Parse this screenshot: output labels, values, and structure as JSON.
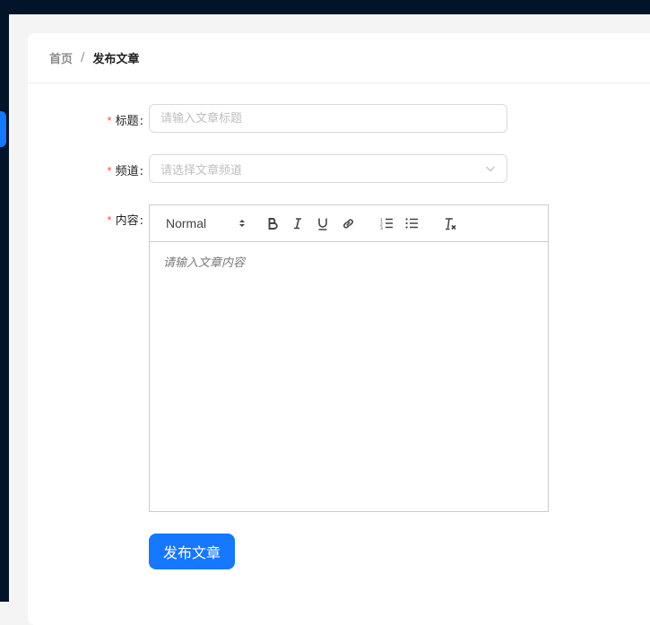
{
  "breadcrumb": {
    "home": "首页",
    "separator": "/",
    "current": "发布文章"
  },
  "form": {
    "title": {
      "label": "标题",
      "placeholder": "请输入文章标题",
      "value": ""
    },
    "channel": {
      "label": "频道",
      "placeholder": "请选择文章频道"
    },
    "content": {
      "label": "内容",
      "placeholder": "请输入文章内容"
    },
    "required_mark": "*",
    "colon": ":"
  },
  "editor": {
    "format_select": "Normal",
    "tools": [
      "bold-icon",
      "italic-icon",
      "underline-icon",
      "link-icon",
      "ordered-list-icon",
      "bullet-list-icon",
      "clear-format-icon"
    ]
  },
  "submit": {
    "label": "发布文章"
  },
  "colors": {
    "sidebar": "#011429",
    "accent": "#1677ff",
    "required": "#ff4d4f"
  }
}
